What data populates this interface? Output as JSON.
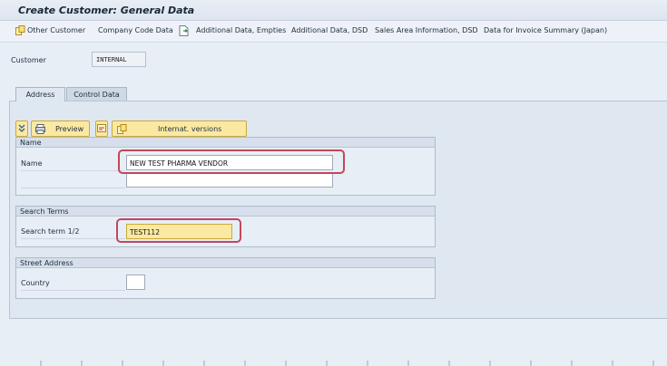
{
  "window": {
    "title": "Create Customer: General Data"
  },
  "toolbar": {
    "items": [
      {
        "label": "Other Customer",
        "icon": "other-customer-icon"
      },
      {
        "label": "Company Code Data"
      },
      {
        "label": "Additional Data, Empties",
        "icon": "document-arrow-icon"
      },
      {
        "label": "Additional Data, DSD"
      },
      {
        "label": "Sales Area Information, DSD"
      },
      {
        "label": "Data for Invoice Summary (Japan)"
      }
    ]
  },
  "header": {
    "customer_label": "Customer",
    "customer_value": "INTERNAL"
  },
  "tabs": [
    {
      "label": "Address",
      "active": true
    },
    {
      "label": "Control Data",
      "active": false
    }
  ],
  "address_toolbar": {
    "preview_label": "Preview",
    "intl_versions_label": "Internat. versions"
  },
  "groups": {
    "name": {
      "header": "Name",
      "field_label": "Name",
      "value_line1": "NEW TEST PHARMA VENDOR",
      "value_line2": ""
    },
    "search_terms": {
      "header": "Search Terms",
      "field_label": "Search term 1/2",
      "value": "TEST112"
    },
    "street_address": {
      "header": "Street Address",
      "country_label": "Country",
      "country_value": ""
    }
  },
  "colors": {
    "highlight": "#c0485a",
    "button_yellow": "#fbe9a2",
    "required_field": "#fbe9a2",
    "background": "#e8eef6"
  }
}
